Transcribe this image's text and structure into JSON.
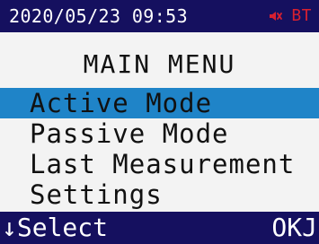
{
  "status_bar": {
    "datetime": "2020/05/23 09:53",
    "mute_icon": "mute-icon",
    "bt_label": "BT"
  },
  "title": "MAIN MENU",
  "menu": {
    "items": [
      {
        "label": "Active Mode",
        "selected": true
      },
      {
        "label": "Passive Mode",
        "selected": false
      },
      {
        "label": "Last Measurement",
        "selected": false
      },
      {
        "label": "Settings",
        "selected": false
      }
    ]
  },
  "bottom_bar": {
    "left": "↓Select",
    "right": "OKJ"
  },
  "colors": {
    "bar_background": "#15105f",
    "screen_background": "#f3f3f3",
    "selection_background": "#1f84c8",
    "status_alert": "#d72030"
  }
}
